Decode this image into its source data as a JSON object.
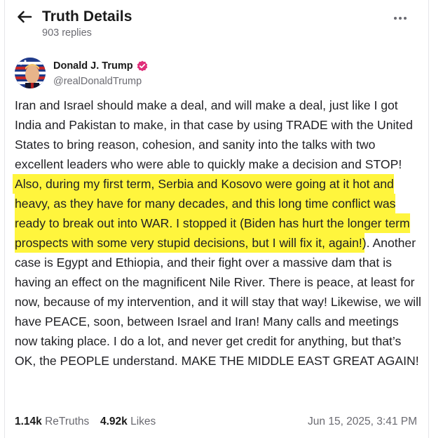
{
  "header": {
    "title": "Truth Details",
    "replies": "903 replies",
    "back_icon": "arrow-left-icon",
    "more_icon": "more-horizontal-icon"
  },
  "author": {
    "name": "Donald J. Trump",
    "handle": "@realDonaldTrump",
    "verified_color": "#e02f7a"
  },
  "post": {
    "part1": "Iran and Israel should make a deal, and will make a deal, just like I got India and Pakistan to make, in that case by using TRADE with the United States to bring reason, cohesion, and sanity into the talks with two excellent leaders who were able to quickly make a decision and STOP! ",
    "highlight": "Also, during my first term, Serbia and Kosovo were going at it hot and heavy, as they have for many decades, and this long time conflict was ready to break out into WAR. I stopped it (Biden has hurt the longer term prospects with some very stupid decisions, but I will fix it, again!",
    "part2": "). Another case is Egypt and Ethiopia, and their fight over a massive dam that is having an effect on the magnificent Nile River. There is peace, at least for now, because of my intervention, and it will stay that way! Likewise, we will have PEACE, soon, between Israel and Iran! Many calls and meetings now taking place. I do a lot, and never get credit for anything, but that’s OK, the PEOPLE understand. MAKE THE MIDDLE EAST GREAT AGAIN!"
  },
  "footer": {
    "retruths_count": "1.14k",
    "retruths_label": "ReTruths",
    "likes_count": "4.92k",
    "likes_label": "Likes",
    "timestamp": "Jun 15, 2025, 3:41 PM"
  },
  "colors": {
    "highlight": "#fff53d",
    "muted_text": "#6b6b72"
  }
}
